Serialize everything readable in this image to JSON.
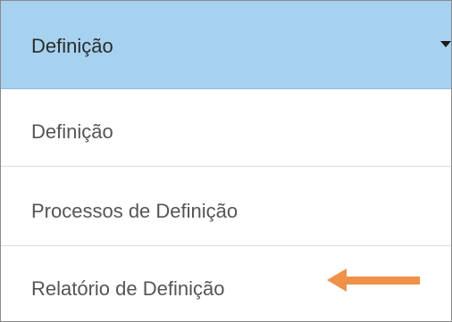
{
  "dropdown": {
    "selected_label": "Definição",
    "caret_icon": "caret-down-icon",
    "items": [
      {
        "label": "Definição"
      },
      {
        "label": "Processos de Definição"
      },
      {
        "label": "Relatório de Definição"
      }
    ]
  },
  "annotation": {
    "icon": "arrow-left-icon",
    "color": "#f0914a"
  },
  "colors": {
    "header_background": "#a6d2f0",
    "item_text": "#555555",
    "header_text": "#2b2b2b",
    "divider": "#dddddd"
  }
}
